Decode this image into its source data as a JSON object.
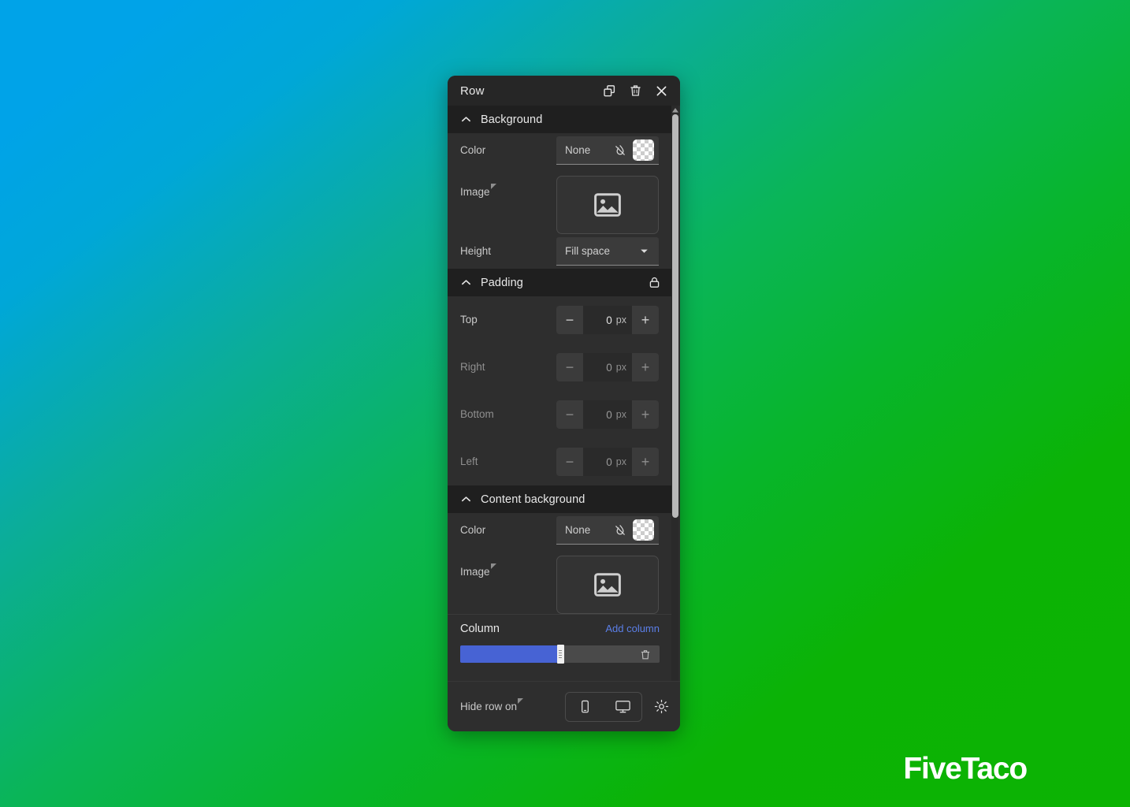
{
  "panel": {
    "title": "Row",
    "title_actions": [
      {
        "name": "duplicate-icon",
        "label": "Duplicate"
      },
      {
        "name": "trash-icon",
        "label": "Delete"
      },
      {
        "name": "close-icon",
        "label": "Close"
      }
    ],
    "sections": {
      "background": {
        "title": "Background",
        "color": {
          "label": "Color",
          "value": "None"
        },
        "image": {
          "label": "Image"
        },
        "height": {
          "label": "Height",
          "value": "Fill space"
        }
      },
      "padding": {
        "title": "Padding",
        "unit": "px",
        "fields": [
          {
            "label": "Top",
            "value": "0",
            "active": true
          },
          {
            "label": "Right",
            "value": "0",
            "active": false
          },
          {
            "label": "Bottom",
            "value": "0",
            "active": false
          },
          {
            "label": "Left",
            "value": "0",
            "active": false
          }
        ]
      },
      "content_background": {
        "title": "Content background",
        "color": {
          "label": "Color",
          "value": "None"
        },
        "image": {
          "label": "Image"
        }
      },
      "column": {
        "title": "Column",
        "add_label": "Add column",
        "fill_percent": "49"
      }
    },
    "footer": {
      "label": "Hide row on",
      "devices": [
        {
          "name": "mobile-icon",
          "label": "Mobile"
        },
        {
          "name": "desktop-icon",
          "label": "Desktop"
        }
      ],
      "settings": {
        "name": "gear-icon",
        "label": "Settings"
      }
    }
  },
  "watermark": {
    "text": "FiveTaco"
  },
  "colors": {
    "accent_blue": "#4763d4",
    "link_blue": "#5b7fe8",
    "panel_bg": "#2e2e2e",
    "section_header_bg": "#1f1f1f",
    "titlebar_bg": "#262626",
    "gradient_start": "#00a3e8",
    "gradient_end": "#0cb303"
  }
}
